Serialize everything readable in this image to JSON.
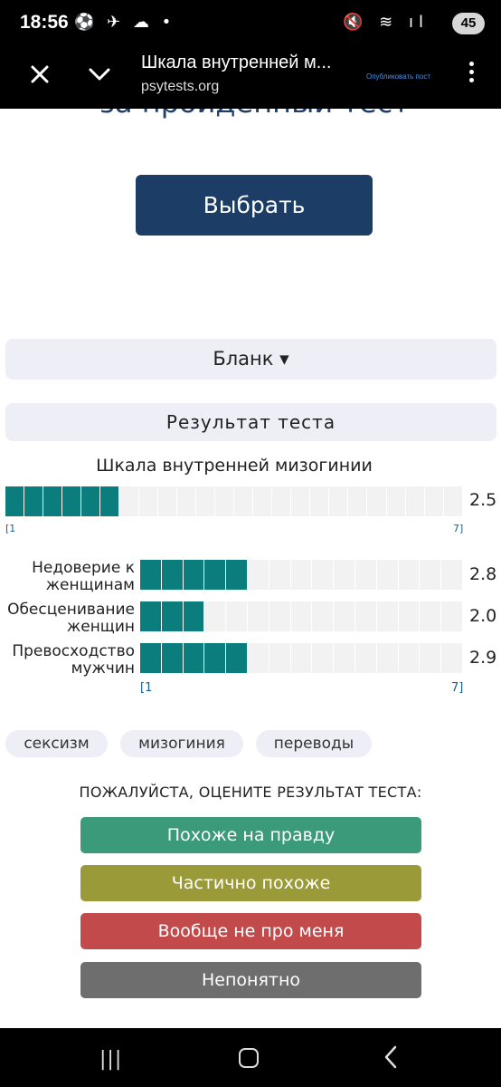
{
  "status_bar": {
    "time": "18:56",
    "left_icons": "⚽ ✈ ☁ •",
    "right_icons": "🔇 ≋ ıl",
    "battery": "45"
  },
  "top_bar": {
    "title": "Шкала внутренней м...",
    "url": "psytests.org",
    "publish_label": "Опубликовать пост",
    "close_icon": "close-icon",
    "chevron_icon": "chevron-down-icon",
    "menu_icon": "more-vertical-icon"
  },
  "page": {
    "heading_partial": "за пройденный тест",
    "choose_button": "Выбрать",
    "blank_label": "Бланк ▾",
    "result_label": "Результат теста",
    "scale_title": "Шкала внутренней мизогинии",
    "main_scale": {
      "value": "2.5",
      "level": 2.5,
      "min_label": "[1",
      "max_label": "7]"
    },
    "subscales": [
      {
        "label": "Недоверие к женщинам",
        "value": "2.8",
        "level": 2.8
      },
      {
        "label": "Обесценивание женщин",
        "value": "2.0",
        "level": 2.0
      },
      {
        "label": "Превосходство мужчин",
        "value": "2.9",
        "level": 2.9
      }
    ],
    "sub_min_label": "[1",
    "sub_max_label": "7]",
    "tags": [
      "сексизм",
      "мизогиния",
      "переводы"
    ],
    "rate_title": "ПОЖАЛУЙСТА, ОЦЕНИТЕ РЕЗУЛЬТАТ ТЕСТА:",
    "rate_buttons": [
      {
        "label": "Похоже на правду",
        "color": "#3a9a7a"
      },
      {
        "label": "Частично похоже",
        "color": "#9a9a38"
      },
      {
        "label": "Вообще не про меня",
        "color": "#c24a4a"
      },
      {
        "label": "Непонятно",
        "color": "#6e6e6e"
      }
    ]
  },
  "colors": {
    "accent": "#1c3d66",
    "bar_fill": "#0c7d7d",
    "bar_empty": "#f2f2f2"
  }
}
